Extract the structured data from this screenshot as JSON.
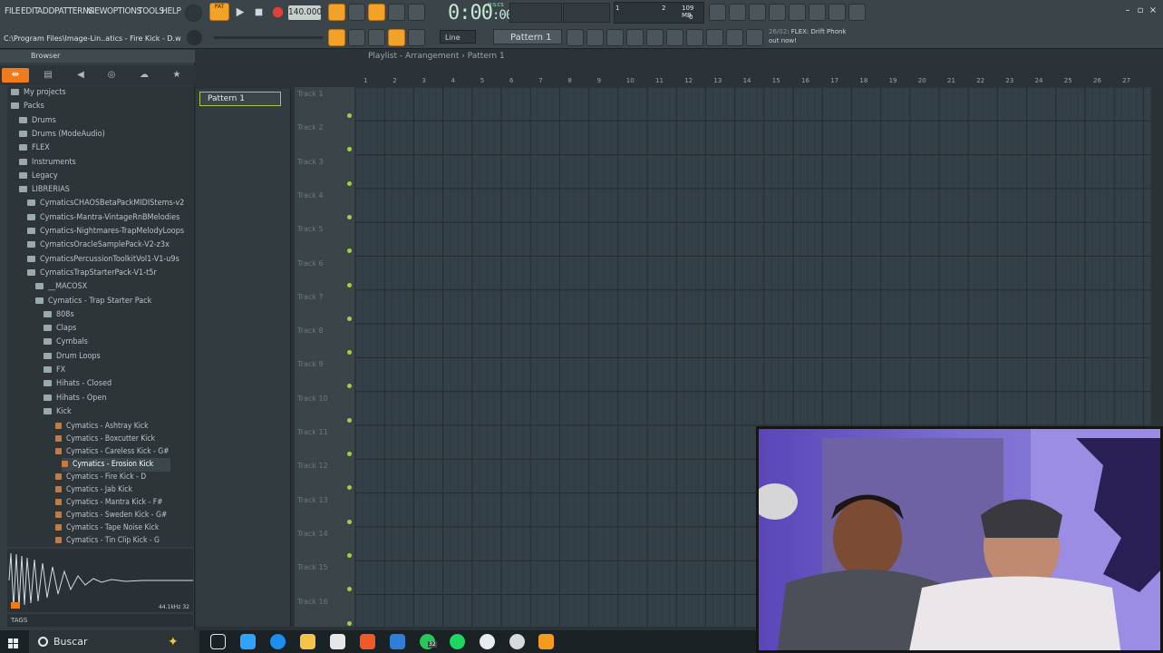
{
  "menu": [
    "FILE",
    "EDIT",
    "ADD",
    "PATTERNS",
    "VIEW",
    "OPTIONS",
    "TOOLS",
    "HELP"
  ],
  "transport": {
    "pat_label": "PAT",
    "tempo": "140.000",
    "time": "0:00",
    "time_small": ":00",
    "time_unit": "M:S:CS"
  },
  "cpu": {
    "value": "1",
    "mem": "109 MB",
    "voices": "0",
    "poly": "2"
  },
  "hint_bar": "C:\\Program Files\\Image-Lin..atics - Fire Kick - D.wav",
  "pattern_selector": "Pattern 1",
  "snap": "Line",
  "news": {
    "date": "26/02",
    "line1": "FLEX: Drift Phonk",
    "line2": "out now!"
  },
  "browser": {
    "title": "Browser",
    "items": [
      {
        "label": "My projects",
        "level": 0
      },
      {
        "label": "Packs",
        "level": 0
      },
      {
        "label": "Drums",
        "level": 1
      },
      {
        "label": "Drums (ModeAudio)",
        "level": 1
      },
      {
        "label": "FLEX",
        "level": 1
      },
      {
        "label": "Instruments",
        "level": 1
      },
      {
        "label": "Legacy",
        "level": 1
      },
      {
        "label": "LIBRERIAS",
        "level": 1
      },
      {
        "label": "CymaticsCHAOSBetaPackMIDIStems-v2",
        "level": 2
      },
      {
        "label": "Cymatics-Mantra-VintageRnBMelodies",
        "level": 2
      },
      {
        "label": "Cymatics-Nightmares-TrapMelodyLoops",
        "level": 2
      },
      {
        "label": "CymaticsOracleSamplePack-V2-z3x",
        "level": 2
      },
      {
        "label": "CymaticsPercussionToolkitVol1-V1-u9s",
        "level": 2
      },
      {
        "label": "CymaticsTrapStarterPack-V1-t5r",
        "level": 2
      },
      {
        "label": "__MACOSX",
        "level": 3
      },
      {
        "label": "Cymatics - Trap Starter Pack",
        "level": 3
      },
      {
        "label": "808s",
        "level": 4
      },
      {
        "label": "Claps",
        "level": 4
      },
      {
        "label": "Cymbals",
        "level": 4
      },
      {
        "label": "Drum Loops",
        "level": 4
      },
      {
        "label": "FX",
        "level": 4
      },
      {
        "label": "Hihats - Closed",
        "level": 4
      },
      {
        "label": "Hihats - Open",
        "level": 4
      },
      {
        "label": "Kick",
        "level": 4
      }
    ],
    "files": [
      "Cymatics - Ashtray Kick",
      "Cymatics - Boxcutter Kick",
      "Cymatics - Careless Kick - G#",
      "Cymatics - Erosion Kick",
      "Cymatics - Fire Kick - D",
      "Cymatics - Jab Kick",
      "Cymatics - Mantra Kick - F#",
      "Cymatics - Sweden Kick - G#",
      "Cymatics - Tape Noise Kick",
      "Cymatics - Tin Clip Kick - G"
    ],
    "wave_info": "44.1kHz 32",
    "tags_label": "TAGS"
  },
  "playlist": {
    "title": "Playlist - Arrangement",
    "pattern": "Pattern 1",
    "pattern_item": "Pattern 1",
    "tracks": [
      "Track 1",
      "Track 2",
      "Track 3",
      "Track 4",
      "Track 5",
      "Track 6",
      "Track 7",
      "Track 8",
      "Track 9",
      "Track 10",
      "Track 11",
      "Track 12",
      "Track 13",
      "Track 14",
      "Track 15",
      "Track 16"
    ],
    "bars": [
      "1",
      "2",
      "3",
      "4",
      "5",
      "6",
      "7",
      "8",
      "9",
      "10",
      "11",
      "12",
      "13",
      "14",
      "15",
      "16",
      "17",
      "18",
      "19",
      "20",
      "21",
      "22",
      "23",
      "24",
      "25",
      "26",
      "27"
    ]
  },
  "taskbar": {
    "search_placeholder": "Buscar",
    "whatsapp_badge": "32"
  }
}
